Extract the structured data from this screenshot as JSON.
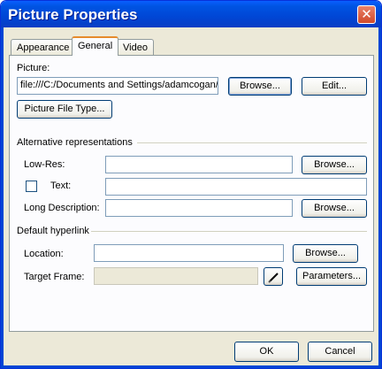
{
  "window": {
    "title": "Picture Properties",
    "close_symbol": "✕"
  },
  "tabs": [
    {
      "label": "Appearance",
      "active": false
    },
    {
      "label": "General",
      "active": true
    },
    {
      "label": "Video",
      "active": false
    }
  ],
  "picture": {
    "label": "Picture:",
    "path_value": "file:///C:/Documents and Settings/adamcogan/",
    "browse_label": "Browse...",
    "edit_label": "Edit...",
    "file_type_label": "Picture File Type..."
  },
  "alt": {
    "group_label": "Alternative representations",
    "lowres_label": "Low-Res:",
    "lowres_value": "",
    "lowres_browse": "Browse...",
    "text_label": "Text:",
    "text_value": "",
    "text_checked": false,
    "longdesc_label": "Long Description:",
    "longdesc_value": "",
    "longdesc_browse": "Browse..."
  },
  "hyperlink": {
    "group_label": "Default hyperlink",
    "location_label": "Location:",
    "location_value": "",
    "location_browse": "Browse...",
    "target_label": "Target Frame:",
    "target_value": "",
    "parameters_label": "Parameters..."
  },
  "footer": {
    "ok_label": "OK",
    "cancel_label": "Cancel"
  }
}
